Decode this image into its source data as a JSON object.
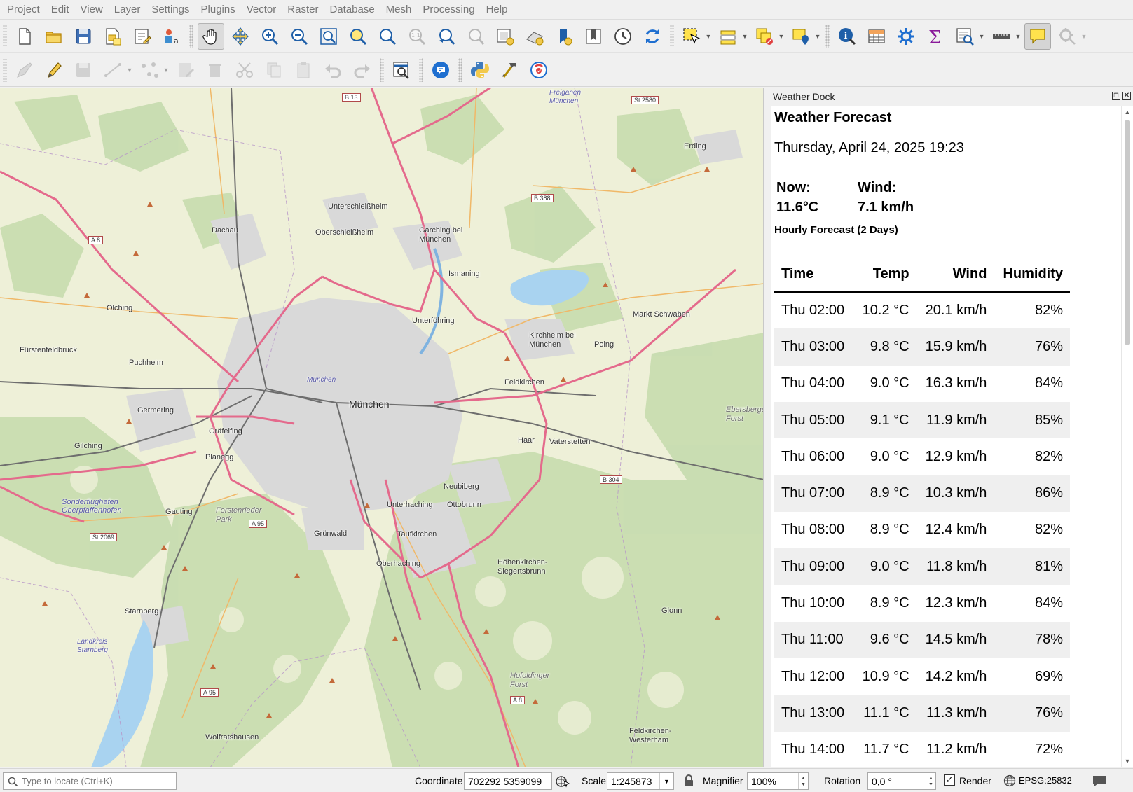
{
  "menubar": {
    "items": [
      "Project",
      "Edit",
      "View",
      "Layer",
      "Settings",
      "Plugins",
      "Vector",
      "Raster",
      "Database",
      "Mesh",
      "Processing",
      "Help"
    ]
  },
  "map": {
    "labels": {
      "munchen": "München",
      "dachau": "Dachau",
      "unterschleissheim": "Unterschleißheim",
      "oberschleissheim": "Oberschleißheim",
      "garching": "Garching bei München",
      "ismaning": "Ismaning",
      "unterfohring": "Unterföhring",
      "kirchheim": "Kirchheim bei München",
      "poing": "Poing",
      "markt_schwaben": "Markt Schwaben",
      "erding": "Erding",
      "olching": "Olching",
      "fursten": "Fürstenfeldbruck",
      "puchheim": "Puchheim",
      "germering": "Germering",
      "grafelfing": "Gräfelfing",
      "planegg": "Planegg",
      "gilching": "Gilching",
      "gauting": "Gauting",
      "grunwald": "Grünwald",
      "unterhaching": "Unterhaching",
      "ottobrunn": "Ottobrunn",
      "neubiberg": "Neubiberg",
      "taufkirchen": "Taufkirchen",
      "oberhaching": "Oberhaching",
      "feldkirchen": "Feldkirchen",
      "haar": "Haar",
      "vaterstetten": "Vaterstetten",
      "hohenkirchen": "Höhenkirchen-Siegertsbrunn",
      "starnberg": "Starnberg",
      "wolfratshausen": "Wolfratshausen",
      "glonn": "Glonn",
      "feldkirchen_westerham": "Feldkirchen-Westerham",
      "sonderflughafen": "Sonderflughafen Oberpfaffenhofen",
      "landkreis_starnberg": "Landkreis Starnberg",
      "forstenrieder": "Forstenrieder Park",
      "hofoldinger": "Hofoldinger Forst",
      "ebersberger": "Ebersberger Forst",
      "freiganen": "Freigänen München",
      "munchen_small": "München"
    },
    "roads": {
      "b13": "B 13",
      "st2580": "St 2580",
      "b388": "B 388",
      "a8_nw": "A 8",
      "a95": "A 95",
      "st2069": "St 2069",
      "b304": "B 304",
      "a95_s": "A 95",
      "a8_se": "A 8"
    }
  },
  "dock": {
    "window_title": "Weather Dock",
    "title": "Weather Forecast",
    "datetime": "Thursday, April 24, 2025 19:23",
    "now_label": "Now:",
    "now_value": "11.6°C",
    "wind_label": "Wind:",
    "wind_value": "7.1 km/h",
    "hourly_heading": "Hourly Forecast (2 Days)",
    "table": {
      "headers": [
        "Time",
        "Temp",
        "Wind",
        "Humidity"
      ],
      "rows": [
        {
          "time": "Thu 02:00",
          "temp": "10.2 °C",
          "wind": "20.1 km/h",
          "humidity": "82%"
        },
        {
          "time": "Thu 03:00",
          "temp": "9.8 °C",
          "wind": "15.9 km/h",
          "humidity": "76%"
        },
        {
          "time": "Thu 04:00",
          "temp": "9.0 °C",
          "wind": "16.3 km/h",
          "humidity": "84%"
        },
        {
          "time": "Thu 05:00",
          "temp": "9.1 °C",
          "wind": "11.9 km/h",
          "humidity": "85%"
        },
        {
          "time": "Thu 06:00",
          "temp": "9.0 °C",
          "wind": "12.9 km/h",
          "humidity": "82%"
        },
        {
          "time": "Thu 07:00",
          "temp": "8.9 °C",
          "wind": "10.3 km/h",
          "humidity": "86%"
        },
        {
          "time": "Thu 08:00",
          "temp": "8.9 °C",
          "wind": "12.4 km/h",
          "humidity": "82%"
        },
        {
          "time": "Thu 09:00",
          "temp": "9.0 °C",
          "wind": "11.8 km/h",
          "humidity": "81%"
        },
        {
          "time": "Thu 10:00",
          "temp": "8.9 °C",
          "wind": "12.3 km/h",
          "humidity": "84%"
        },
        {
          "time": "Thu 11:00",
          "temp": "9.6 °C",
          "wind": "14.5 km/h",
          "humidity": "78%"
        },
        {
          "time": "Thu 12:00",
          "temp": "10.9 °C",
          "wind": "14.2 km/h",
          "humidity": "69%"
        },
        {
          "time": "Thu 13:00",
          "temp": "11.1 °C",
          "wind": "11.3 km/h",
          "humidity": "76%"
        },
        {
          "time": "Thu 14:00",
          "temp": "11.7 °C",
          "wind": "11.2 km/h",
          "humidity": "72%"
        }
      ]
    }
  },
  "statusbar": {
    "locator_placeholder": "Type to locate (Ctrl+K)",
    "coordinate_label": "Coordinate",
    "coordinate_value": "702292  5359099",
    "scale_label": "Scale",
    "scale_value": "1:245873",
    "magnifier_label": "Magnifier",
    "magnifier_value": "100%",
    "rotation_label": "Rotation",
    "rotation_value": "0,0 °",
    "render_label": "Render",
    "render_checked": true,
    "crs": "EPSG:25832"
  },
  "colors": {
    "accent_blue": "#1f6fd0",
    "highlight_yellow": "#ffe24d",
    "map_background": "#eef0d8",
    "forest": "#c8dcb0",
    "urban": "#d9d9d9",
    "motorway": "#e46a8c",
    "water": "#a9d3f0"
  }
}
